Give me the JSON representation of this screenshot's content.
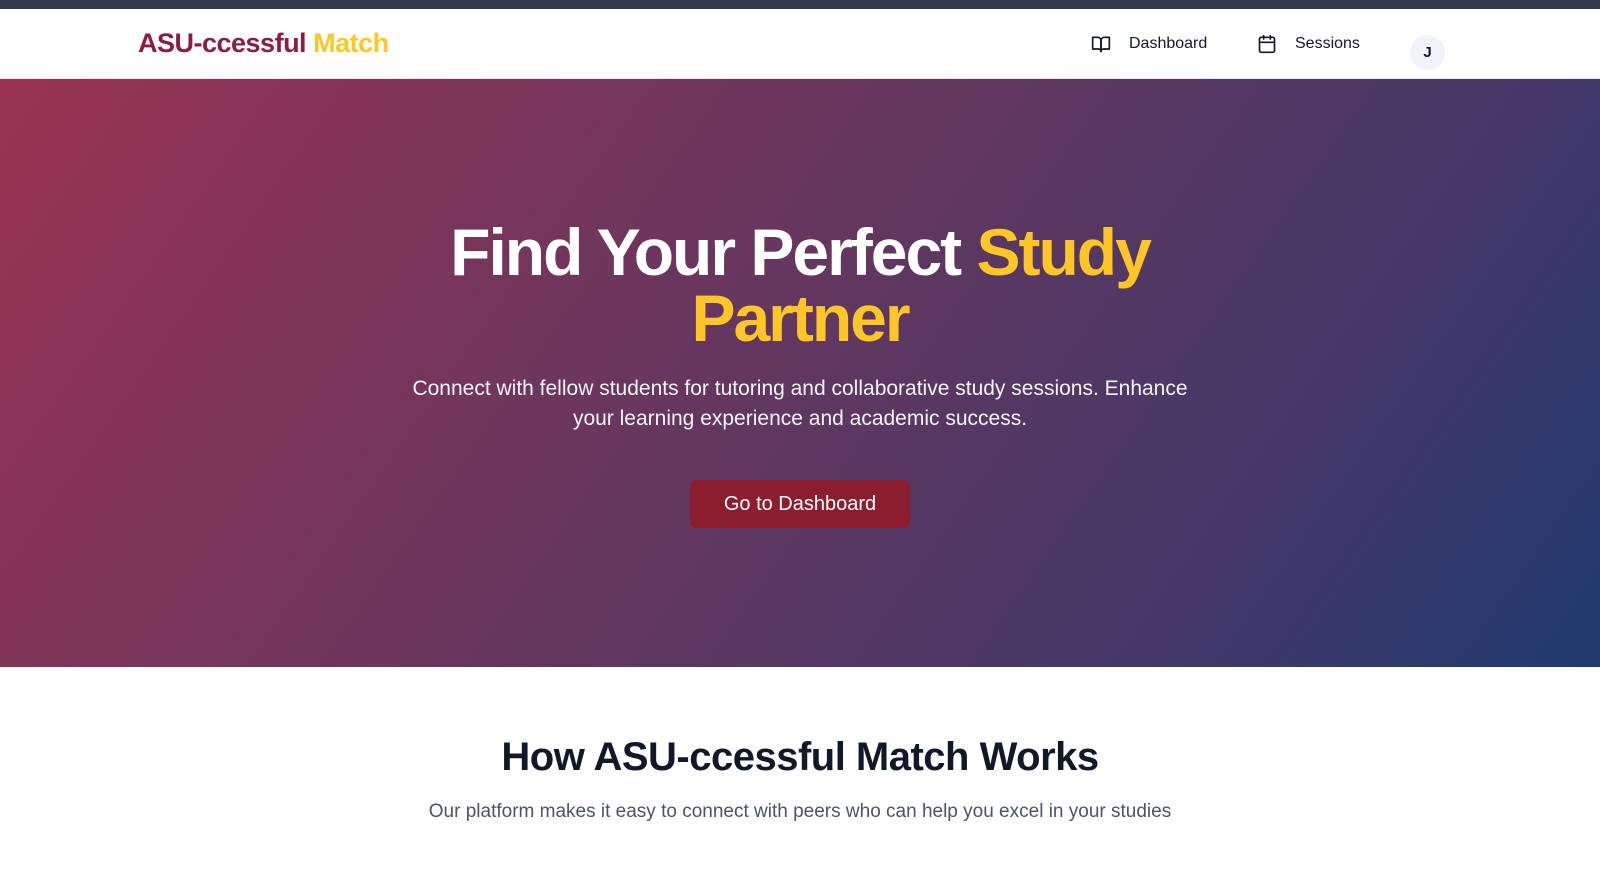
{
  "brand": {
    "part1": "ASU-ccessful",
    "part2": "Match"
  },
  "nav": {
    "dashboard": "Dashboard",
    "sessions": "Sessions",
    "avatar_initial": "J"
  },
  "hero": {
    "title_main": "Find Your Perfect",
    "title_highlight_1": "Study",
    "title_highlight_2": "Partner",
    "subtitle_line1": "Connect with fellow students for tutoring and collaborative study sessions. Enhance",
    "subtitle_line2": "your learning experience and academic success.",
    "cta_label": "Go to Dashboard"
  },
  "how_it_works": {
    "title": "How ASU-ccessful Match Works",
    "subtitle": "Our platform makes it easy to connect with peers who can help you excel in your studies"
  },
  "icons": {
    "dashboard": "book-open-icon",
    "sessions": "calendar-icon"
  },
  "colors": {
    "maroon": "#8c1d40",
    "gold": "#ffc627",
    "cta": "#8c1d2f"
  }
}
